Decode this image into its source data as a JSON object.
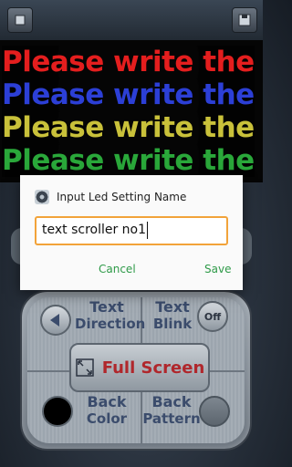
{
  "led": {
    "lines": [
      {
        "text": "Please write the",
        "color": "#e41e1e"
      },
      {
        "text": "Please write the",
        "color": "#2c3fd6"
      },
      {
        "text": "Please write the",
        "color": "#c9c13a"
      },
      {
        "text": "Please write the",
        "color": "#2aa83a"
      }
    ]
  },
  "panel": {
    "text_direction": {
      "l1": "Text",
      "l2": "Direction"
    },
    "text_blink": {
      "l1": "Text",
      "l2": "Blink"
    },
    "blink_toggle": "Off",
    "fullscreen": "Full Screen",
    "back_color": {
      "l1": "Back",
      "l2": "Color"
    },
    "back_pattern": {
      "l1": "Back",
      "l2": "Pattern"
    }
  },
  "dialog": {
    "title": "Input Led Setting Name",
    "input_value": "text scroller no1",
    "cancel": "Cancel",
    "save": "Save",
    "accent": "#2e9a48",
    "input_border": "#f2a33a"
  }
}
